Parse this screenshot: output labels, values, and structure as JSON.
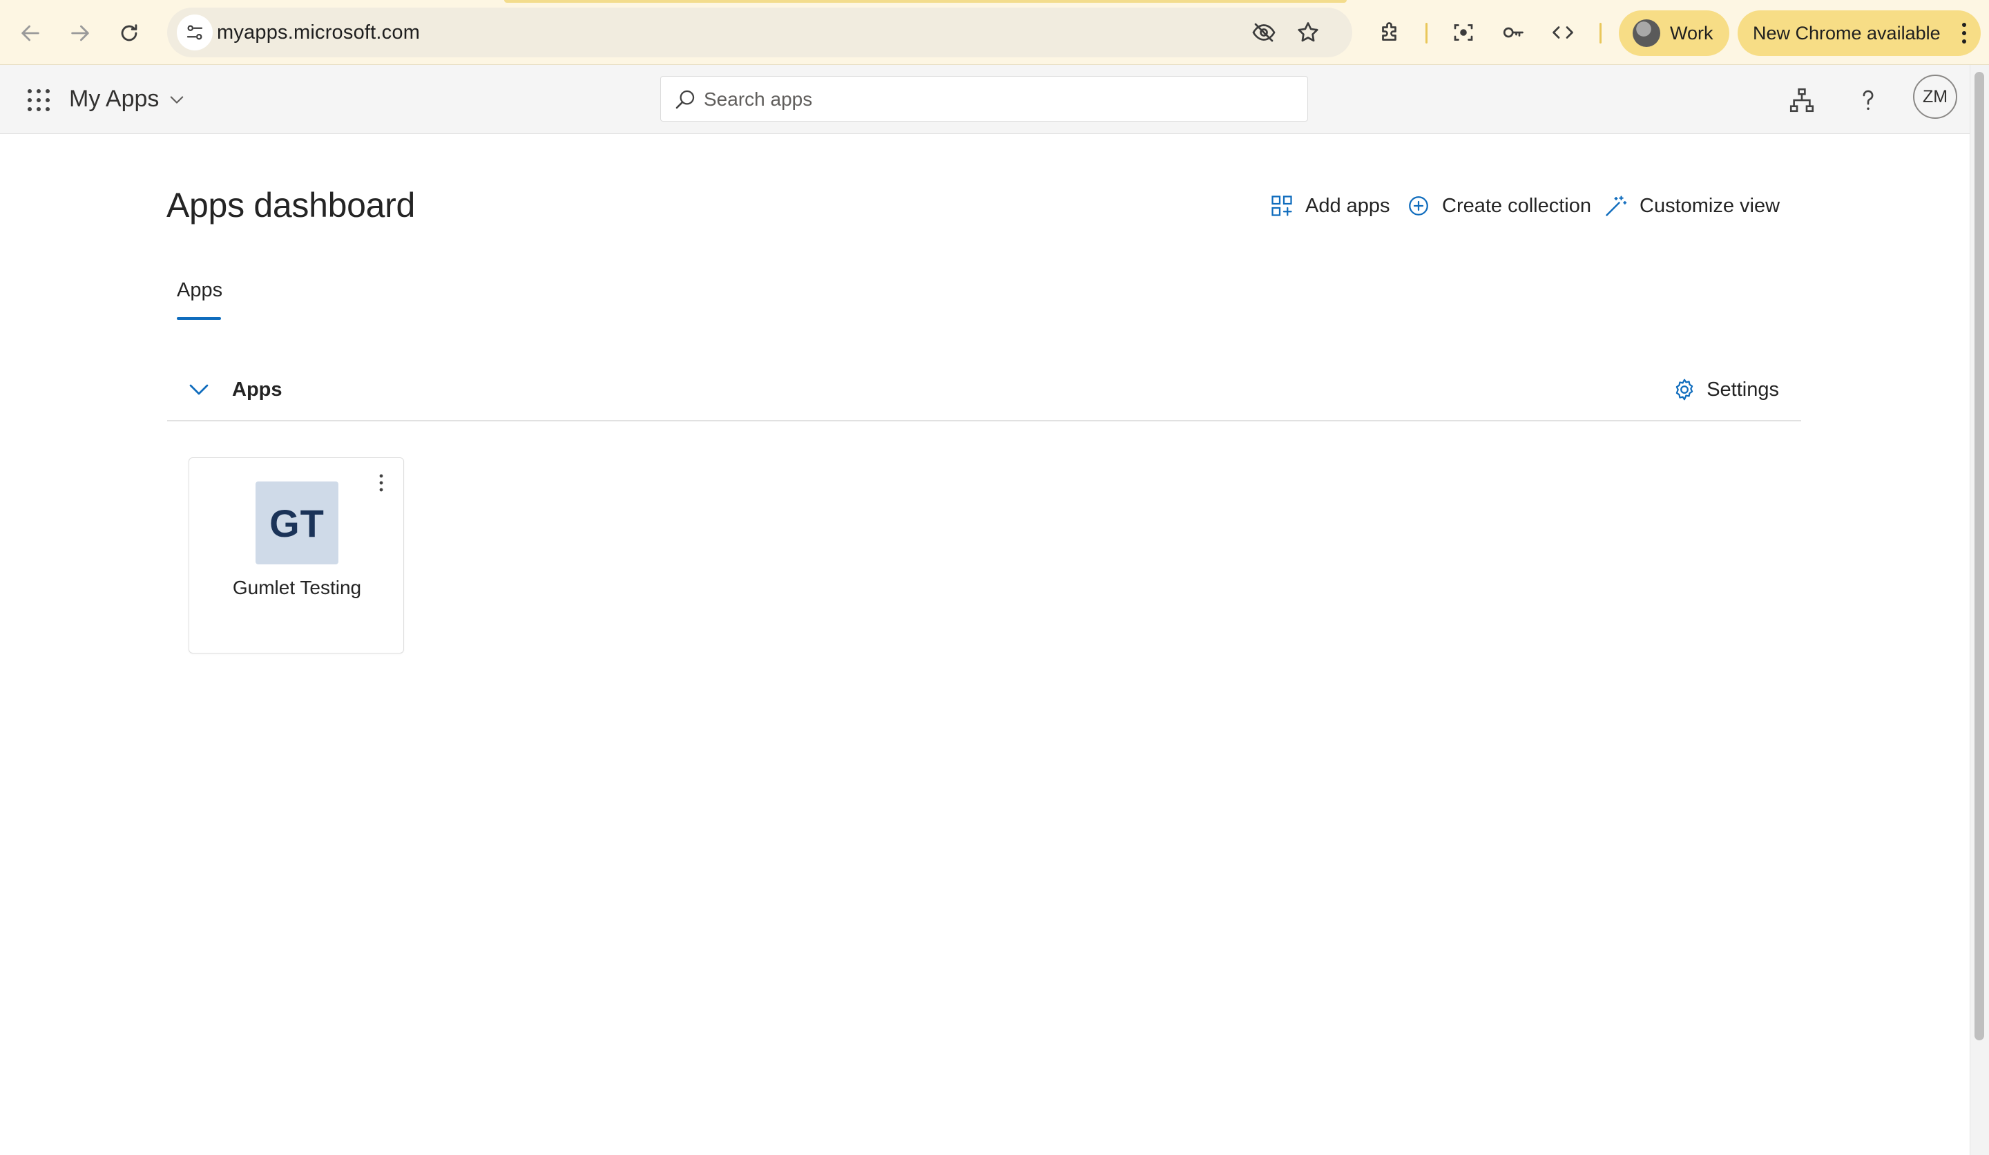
{
  "browser": {
    "url": "myapps.microsoft.com",
    "profile_label": "Work",
    "update_label": "New Chrome available"
  },
  "header": {
    "brand": "My Apps",
    "search_placeholder": "Search apps",
    "avatar_initials": "ZM"
  },
  "page": {
    "title": "Apps dashboard",
    "actions": {
      "add_apps": "Add apps",
      "create_collection": "Create collection",
      "customize_view": "Customize view"
    },
    "tabs": [
      {
        "label": "Apps",
        "selected": true
      }
    ],
    "section": {
      "title": "Apps",
      "settings_label": "Settings"
    },
    "apps": [
      {
        "initials": "GT",
        "name": "Gumlet Testing",
        "tile_color": "#cfdae8",
        "text_color": "#1b3358"
      }
    ]
  },
  "colors": {
    "accent": "#0f6cbd",
    "chrome_chip": "#f7dd86"
  }
}
